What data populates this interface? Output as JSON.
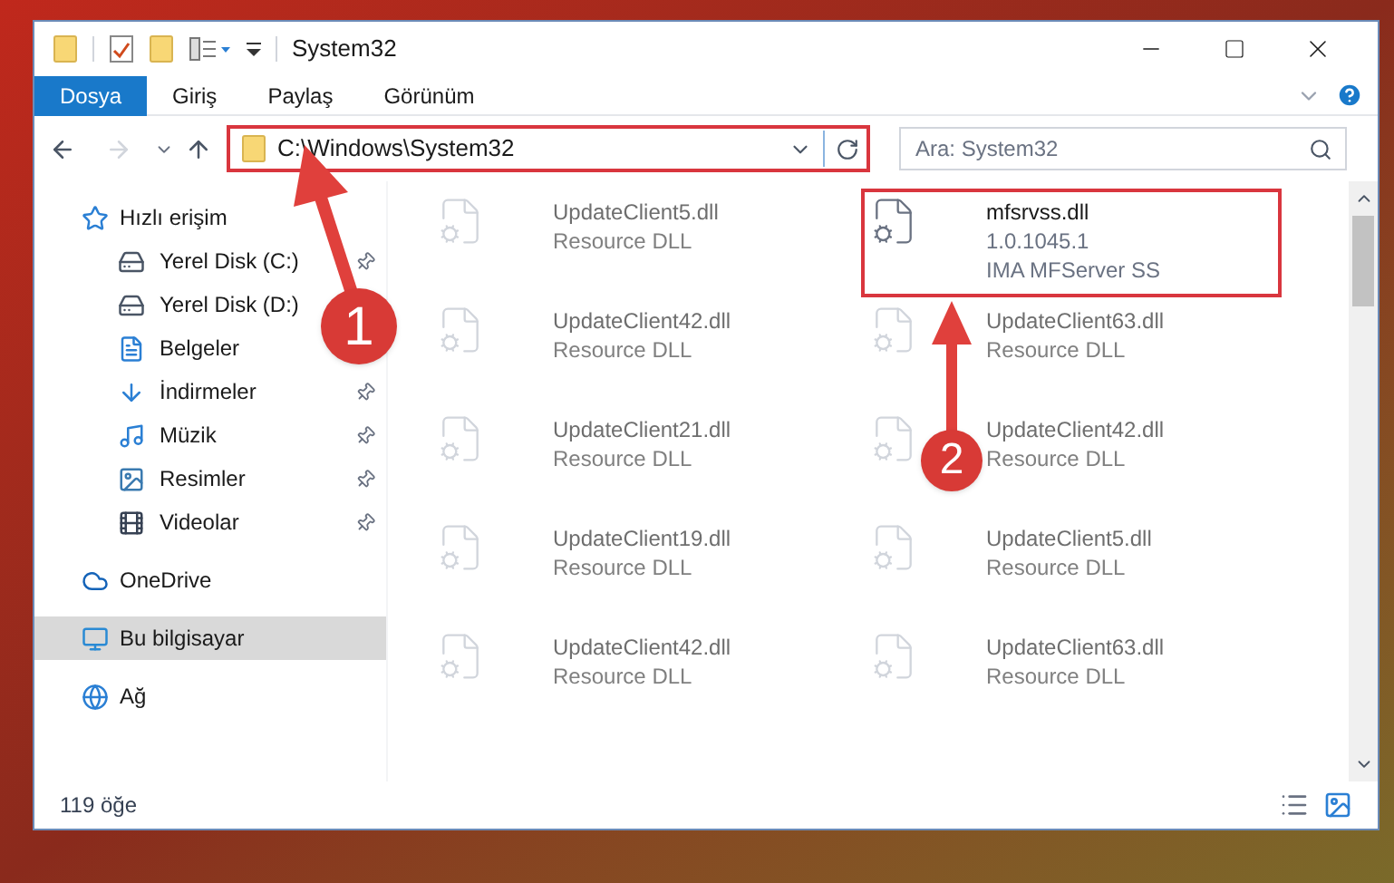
{
  "window": {
    "title": "System32"
  },
  "ribbon_tabs": [
    {
      "label": "Dosya",
      "kind": "file"
    },
    {
      "label": "Giriş",
      "kind": "tab"
    },
    {
      "label": "Paylaş",
      "kind": "tab"
    },
    {
      "label": "Görünüm",
      "kind": "tab"
    }
  ],
  "address_bar": {
    "path": "C:\\Windows\\System32"
  },
  "search": {
    "placeholder": "Ara: System32"
  },
  "sidebar": {
    "items": [
      {
        "label": "Hızlı erişim",
        "selected": false,
        "children": [
          {
            "label": "Yerel Disk (C:)",
            "pinned": true,
            "selected": false
          },
          {
            "label": "Yerel Disk (D:)",
            "selected": false
          },
          {
            "label": "Belgeler",
            "selected": false
          },
          {
            "label": "İndirmeler",
            "pinned": true,
            "selected": false
          },
          {
            "label": "Müzik",
            "pinned": true,
            "selected": false
          },
          {
            "label": "Resimler",
            "pinned": true,
            "selected": false
          },
          {
            "label": "Videolar",
            "pinned": true,
            "selected": false
          }
        ]
      },
      {
        "label": "OneDrive",
        "selected": false
      },
      {
        "label": "Bu bilgisayar",
        "selected": true
      },
      {
        "label": "Ağ",
        "selected": false
      }
    ]
  },
  "files": [
    {
      "name": "UpdateClient5.dll",
      "lines": [
        "Resource DLL"
      ],
      "blurred": true,
      "highlighted": false
    },
    {
      "name": "mfsrvss.dll",
      "lines": [
        "1.0.1045.1",
        "IMA MFServer SS"
      ],
      "blurred": false,
      "highlighted": true
    },
    {
      "name": "UpdateClient42.dll",
      "lines": [
        "Resource DLL"
      ],
      "blurred": true,
      "highlighted": false
    },
    {
      "name": "UpdateClient63.dll",
      "lines": [
        "Resource DLL"
      ],
      "blurred": true,
      "highlighted": false
    },
    {
      "name": "UpdateClient21.dll",
      "lines": [
        "Resource DLL"
      ],
      "blurred": true,
      "highlighted": false
    },
    {
      "name": "UpdateClient42.dll",
      "lines": [
        "Resource DLL"
      ],
      "blurred": true,
      "highlighted": false
    },
    {
      "name": "UpdateClient19.dll",
      "lines": [
        "Resource DLL"
      ],
      "blurred": true,
      "highlighted": false
    },
    {
      "name": "UpdateClient5.dll",
      "lines": [
        "Resource DLL"
      ],
      "blurred": true,
      "highlighted": false
    },
    {
      "name": "UpdateClient42.dll",
      "lines": [
        "Resource DLL"
      ],
      "blurred": true,
      "highlighted": false
    },
    {
      "name": "UpdateClient63.dll",
      "lines": [
        "Resource DLL"
      ],
      "blurred": true,
      "highlighted": false
    }
  ],
  "status_bar": {
    "item_count": "119 öğe"
  },
  "annotations": [
    {
      "number": "1"
    },
    {
      "number": "2"
    }
  ]
}
